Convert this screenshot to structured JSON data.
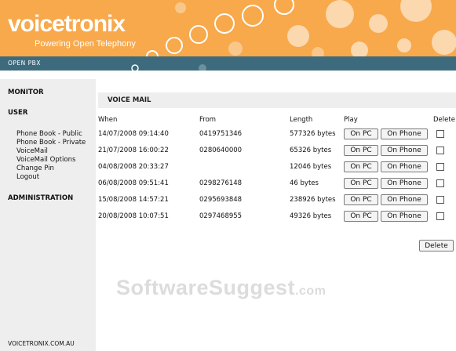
{
  "header": {
    "logo": "voicetronix",
    "tagline": "Powering Open Telephony",
    "bar_label": "OPEN PBX",
    "colors": {
      "banner": "#f7a94c",
      "bar": "#3d6b7d"
    }
  },
  "sidebar": {
    "monitor": "MONITOR",
    "user": "USER",
    "user_links": [
      "Phone Book - Public",
      "Phone Book - Private",
      "VoiceMail",
      "VoiceMail Options",
      "Change Pin",
      "Logout"
    ],
    "administration": "ADMINISTRATION",
    "footer": "VOICETRONIX.COM.AU"
  },
  "main": {
    "title": "VOICE MAIL",
    "columns": {
      "when": "When",
      "from": "From",
      "length": "Length",
      "play": "Play",
      "delete": "Delete"
    },
    "play_pc_label": "On PC",
    "play_phone_label": "On Phone",
    "rows": [
      {
        "when": "14/07/2008 09:14:40",
        "from": "0419751346",
        "length": "577326 bytes"
      },
      {
        "when": "21/07/2008 16:00:22",
        "from": "0280640000",
        "length": "65326 bytes"
      },
      {
        "when": "04/08/2008 20:33:27",
        "from": "",
        "length": "12046 bytes"
      },
      {
        "when": "06/08/2008 09:51:41",
        "from": "0298276148",
        "length": "46 bytes"
      },
      {
        "when": "15/08/2008 14:57:21",
        "from": "0295693848",
        "length": "238926 bytes"
      },
      {
        "when": "20/08/2008 10:07:51",
        "from": "0297468955",
        "length": "49326 bytes"
      }
    ],
    "delete_button": "Delete"
  },
  "watermark": {
    "main": "SoftwareSuggest",
    "suffix": ".com"
  }
}
